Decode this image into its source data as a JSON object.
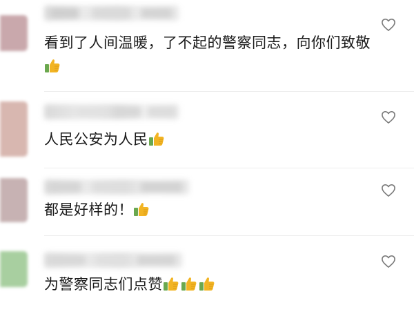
{
  "comments": [
    {
      "text": "看到了人间温暖，了不起的警察同志，向你们致敬",
      "emojis": [
        "thumbs-up"
      ],
      "avatar_color": "#c9a8ac",
      "liked": false
    },
    {
      "text": "人民公安为人民",
      "emojis": [
        "thumbs-up"
      ],
      "avatar_color": "#d8b7b0",
      "liked": false
    },
    {
      "text": "都是好样的！",
      "emojis": [
        "thumbs-up"
      ],
      "avatar_color": "#c7b2b3",
      "liked": false
    },
    {
      "text": "为警察同志们点赞",
      "emojis": [
        "thumbs-up",
        "thumbs-up",
        "thumbs-up"
      ],
      "avatar_color": "#a8cfa0",
      "liked": false
    }
  ],
  "colors": {
    "text": "#1a1a1a",
    "heart_outline": "#7a7a7a",
    "divider": "#ececec",
    "thumb_yellow": "#f2b423",
    "thumb_cuff": "#6aa84f"
  }
}
